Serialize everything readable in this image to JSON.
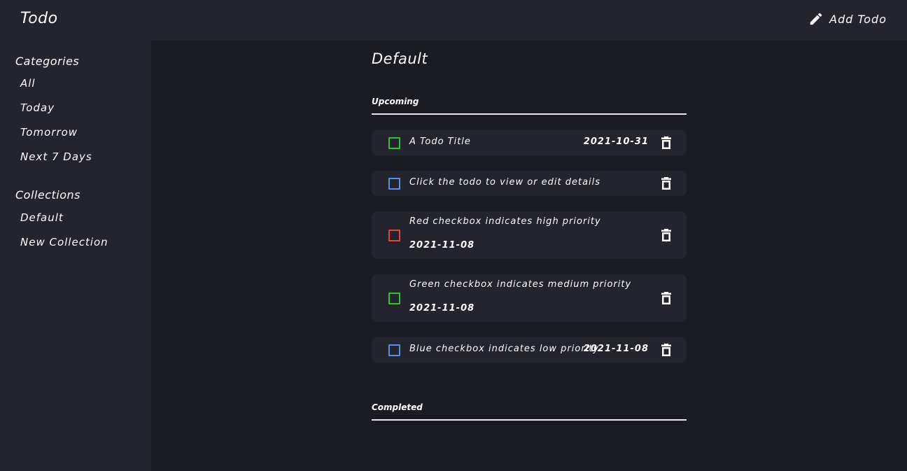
{
  "header": {
    "title": "Todo",
    "add_todo_label": "Add Todo",
    "add_icon": "pencil-icon"
  },
  "sidebar": {
    "categories_heading": "Categories",
    "categories": [
      "All",
      "Today",
      "Tomorrow",
      "Next 7 Days"
    ],
    "collections_heading": "Collections",
    "collections": [
      "Default",
      "New Collection"
    ]
  },
  "main": {
    "title": "Default",
    "upcoming_label": "Upcoming",
    "completed_label": "Completed",
    "todos": [
      {
        "title": "A Todo Title",
        "date": "2021-10-31",
        "priority": "medium"
      },
      {
        "title": "Click the todo to view or edit details",
        "date": "",
        "priority": "low"
      },
      {
        "title": "Red checkbox indicates high priority",
        "date": "2021-11-08",
        "priority": "high"
      },
      {
        "title": "Green checkbox indicates medium priority",
        "date": "2021-11-08",
        "priority": "medium"
      },
      {
        "title": "Blue checkbox indicates low priority",
        "date": "2021-11-08",
        "priority": "low"
      }
    ],
    "delete_icon": "trash-icon"
  },
  "colors": {
    "high": "#e0443a",
    "medium": "#2fc42f",
    "low": "#5b8de8",
    "background": "#1b1c23",
    "panel": "#23242d"
  }
}
